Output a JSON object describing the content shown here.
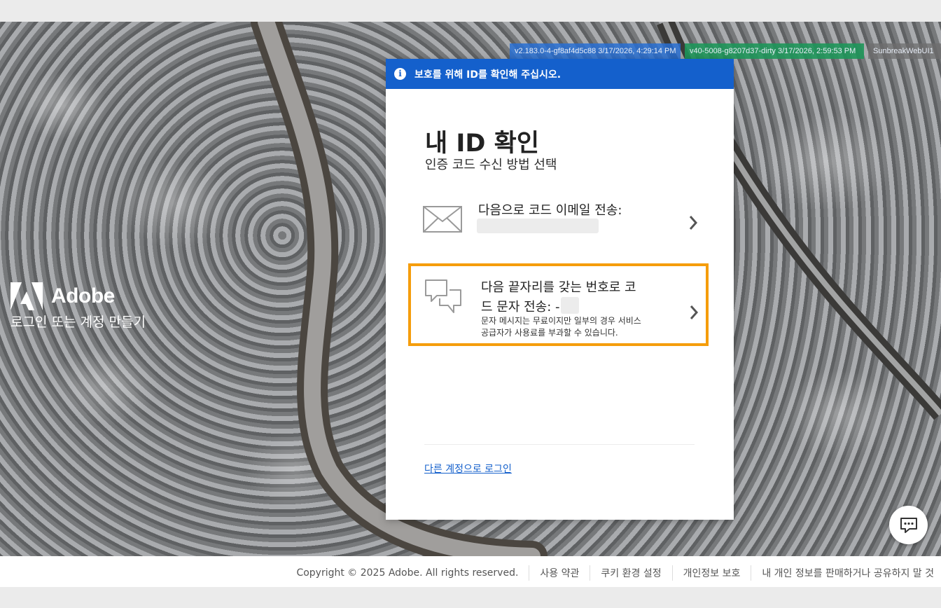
{
  "build_tags": [
    "v2.183.0-4-gf8af4d5c88 3/17/2026, 4:29:14 PM",
    "v40-5008-g8207d37-dirty 3/17/2026, 2:59:53 PM",
    "SunbreakWebUI1"
  ],
  "brand": {
    "name": "Adobe",
    "tagline": "로그인 또는 계정 만들기",
    "logo_icon": "adobe-logo-icon"
  },
  "card": {
    "banner_text": "보호를 위해 ID를 확인해 주십시오.",
    "banner_icon": "info-icon",
    "title": "내 ID 확인",
    "subtitle": "인증 코드 수신 방법 선택",
    "options": [
      {
        "icon": "envelope-icon",
        "title": "다음으로 코드 이메일 전송:"
      },
      {
        "icon": "chat-bubbles-icon",
        "title_line1": "다음 끝자리를 갖는 번호로 코",
        "title_line2": "드 문자 전송: -",
        "note_line1": "문자 메시지는 무료이지만 일부의 경우 서비스",
        "note_line2": "공급자가 사용료를 부과할 수 있습니다."
      }
    ],
    "switch_account_link": "다른 계정으로 로그인"
  },
  "chat_button_icon": "chat-icon",
  "footer": {
    "copyright": "Copyright © 2025 Adobe. All rights reserved.",
    "links": [
      "사용 약관",
      "쿠키 환경 설정",
      "개인정보 보호",
      "내 개인 정보를 판매하거나 공유하지 말 것"
    ]
  },
  "colors": {
    "accent_blue": "#1460cc",
    "highlight_orange": "#f59d0c"
  }
}
